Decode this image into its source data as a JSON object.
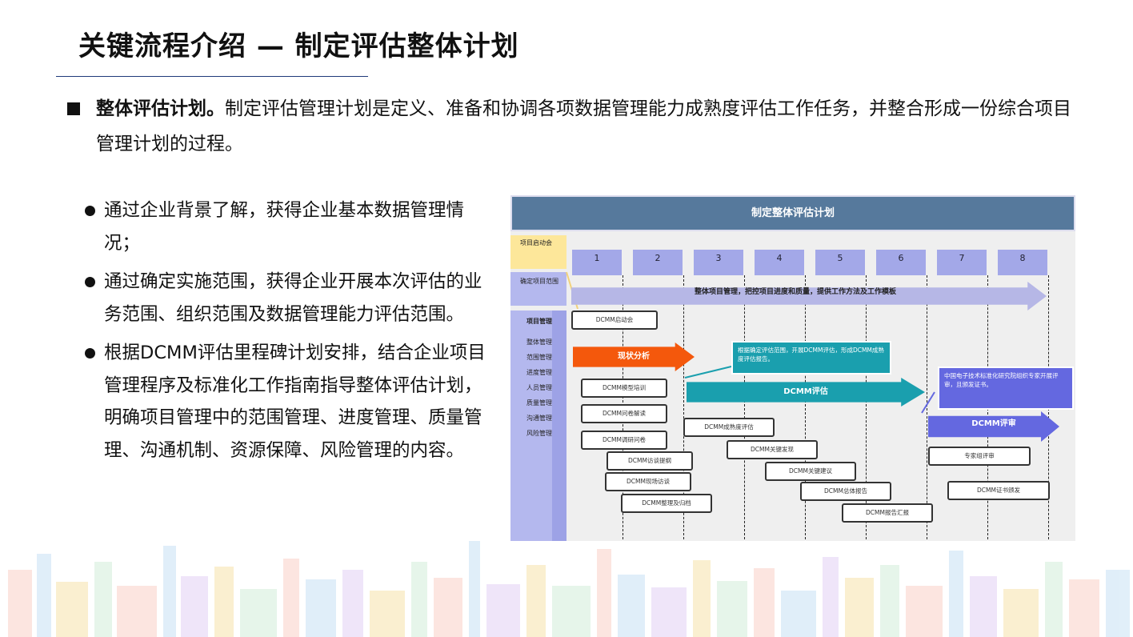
{
  "title": "关键流程介绍 — 制定评估整体计划",
  "intro": {
    "bold": "整体评估计划。",
    "text": "制定评估管理计划是定义、准备和协调各项数据管理能力成熟度评估工作任务，并整合形成一份综合项目管理计划的过程。"
  },
  "bullets": [
    "通过企业背景了解，获得企业基本数据管理情况；",
    "通过确定实施范围，获得企业开展本次评估的业务范围、组织范围及数据管理能力评估范围。",
    "根据DCMM评估里程碑计划安排，结合企业项目管理程序及标准化工作指南指导整体评估计划，明确项目管理中的范围管理、进度管理、质量管理、沟通机制、资源保障、风险管理的内容。"
  ],
  "diagram": {
    "header": "制定整体评估计划",
    "side": {
      "kickoff": "项目启动会",
      "scope": "确定项目范围",
      "pm": "项目管理",
      "items": [
        "整体管理",
        "范围管理",
        "进度管理",
        "人员管理",
        "质量管理",
        "沟通管理",
        "风险管理"
      ]
    },
    "weeks": [
      "1",
      "2",
      "3",
      "4",
      "5",
      "6",
      "7",
      "8"
    ],
    "bar_label": "整体项目管理，把控项目进度和质量，提供工作方法及工作模板",
    "arrows": {
      "status": "现状分析",
      "assess": "DCMM评估",
      "review": "DCMM评审"
    },
    "callouts": {
      "assess": "根据确定评估范围，开展DCMM评估，形成DCMM成熟度评估报告。",
      "review": "中国电子技术标准化研究院组织专家开展评审，且颁发证书。"
    },
    "tasks": {
      "kickoff": "DCMM启动会",
      "training": "DCMM模型培训",
      "questionnaire": "DCMM问卷解读",
      "research": "DCMM调研问卷",
      "interview_outline": "DCMM访谈提纲",
      "onsite": "DCMM现场访谈",
      "archive": "DCMM整理及归档",
      "maturity": "DCMM成熟度评估",
      "findings": "DCMM关键发现",
      "suggestions": "DCMM关键建议",
      "report": "DCMM总体报告",
      "report_summary": "DCMM报告汇报",
      "expert_review": "专家组评审",
      "certificate": "DCMM证书颁发"
    }
  },
  "colors": {
    "header": "#56799c",
    "lavender": "#b4b8ee",
    "week": "#a3a8e8",
    "orange": "#f4580c",
    "teal": "#1a9fae",
    "indigo": "#6468e0",
    "yellow": "#fde79a"
  }
}
